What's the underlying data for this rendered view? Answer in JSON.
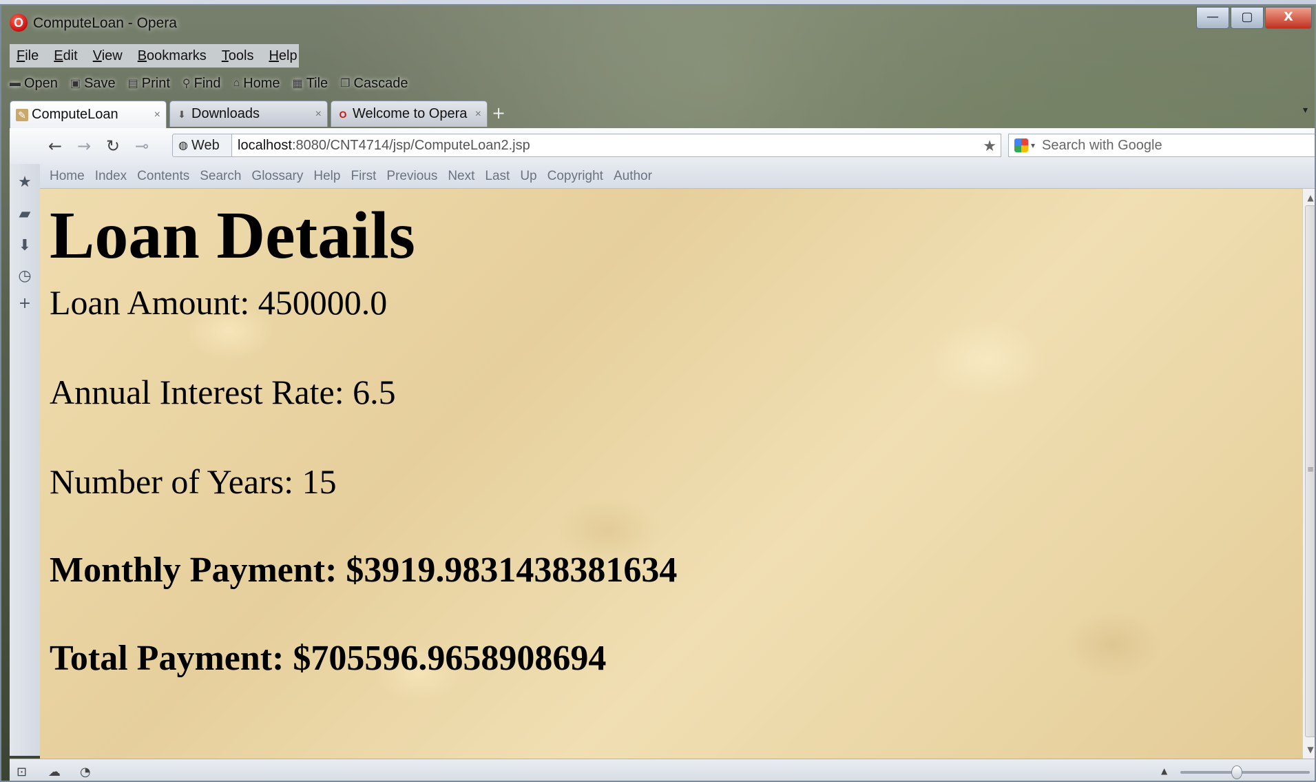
{
  "window": {
    "title": "ComputeLoan - Opera"
  },
  "window_controls": {
    "minimize": "—",
    "maximize": "▢",
    "close": "X"
  },
  "menu": [
    "File",
    "Edit",
    "View",
    "Bookmarks",
    "Tools",
    "Help"
  ],
  "toolbar": [
    {
      "label": "Open",
      "icon": "folder-icon"
    },
    {
      "label": "Save",
      "icon": "save-icon"
    },
    {
      "label": "Print",
      "icon": "print-icon"
    },
    {
      "label": "Find",
      "icon": "find-icon"
    },
    {
      "label": "Home",
      "icon": "home-icon"
    },
    {
      "label": "Tile",
      "icon": "tile-icon"
    },
    {
      "label": "Cascade",
      "icon": "cascade-icon"
    }
  ],
  "tabs": [
    {
      "label": "ComputeLoan",
      "active": true
    },
    {
      "label": "Downloads",
      "active": false
    },
    {
      "label": "Welcome to Opera",
      "active": false
    }
  ],
  "address_bar": {
    "web_button": "Web",
    "host": "localhost",
    "path": ":8080/CNT4714/jsp/ComputeLoan2.jsp"
  },
  "search": {
    "placeholder": "Search with Google"
  },
  "nav_links": [
    "Home",
    "Index",
    "Contents",
    "Search",
    "Glossary",
    "Help",
    "First",
    "Previous",
    "Next",
    "Last",
    "Up",
    "Copyright",
    "Author"
  ],
  "page": {
    "title": "Loan Details",
    "loan_amount": "Loan Amount: 450000.0",
    "interest_rate": "Annual Interest Rate: 6.5",
    "years": "Number of Years: 15",
    "monthly_payment": "Monthly Payment: $3919.9831438381634",
    "total_payment": "Total Payment: $705596.9658908694"
  },
  "colors": {
    "content_background": "#e9d6a6",
    "opera_red": "#cc1111",
    "nav_link": "#6b7380"
  }
}
